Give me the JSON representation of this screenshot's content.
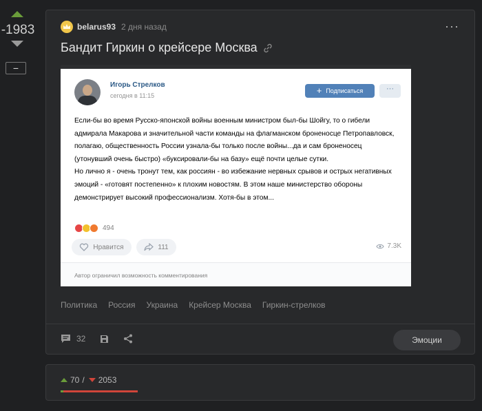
{
  "sidebar": {
    "rating": "-1983",
    "collapse_label": "−"
  },
  "post": {
    "author": "belarus93",
    "time": "2 дня назад",
    "title": "Бандит Гиркин о крейсере Москва",
    "tags": [
      "Политика",
      "Россия",
      "Украина",
      "Крейсер Москва",
      "Гиркин-стрелков"
    ],
    "comments_count": "32",
    "emotions_label": "Эмоции"
  },
  "embed": {
    "name": "Игорь Стрелков",
    "time": "сегодня в 11:15",
    "subscribe_label": "Подписаться",
    "more_label": "···",
    "paragraph1": "Если-бы во время Русско-японской войны военным министром был-бы Шойгу, то о гибели адмирала Макарова и значительной части команды на флагманском броненосце Петропавловск, полагаю, общественность России узнала-бы только после войны...да и сам броненосец (утонувший очень быстро) «буксировали-бы на базу» ещё почти целые сутки.",
    "paragraph2": "Но лично я - очень тронут тем, как россиян - во избежание нервных срывов и острых негативных эмоций - «готовят постепенно» к плохим новостям. В этом наше министерство обороны демонстрирует высокий профессионализм. Хотя-бы в этом...",
    "reactions_count": "494",
    "like_label": "Нравится",
    "share_count": "111",
    "views": "7.3K",
    "footer_note": "Автор ограничил возможность комментирования"
  },
  "votes": {
    "pluses": "70",
    "separator": "/",
    "minuses": "2053",
    "plus_fraction": 0.033
  },
  "colors": {
    "background": "#1f2022",
    "card": "#28292b",
    "vote_up": "#6a9c3a",
    "vote_down": "#d0453a",
    "vk_blue": "#5181b8"
  }
}
